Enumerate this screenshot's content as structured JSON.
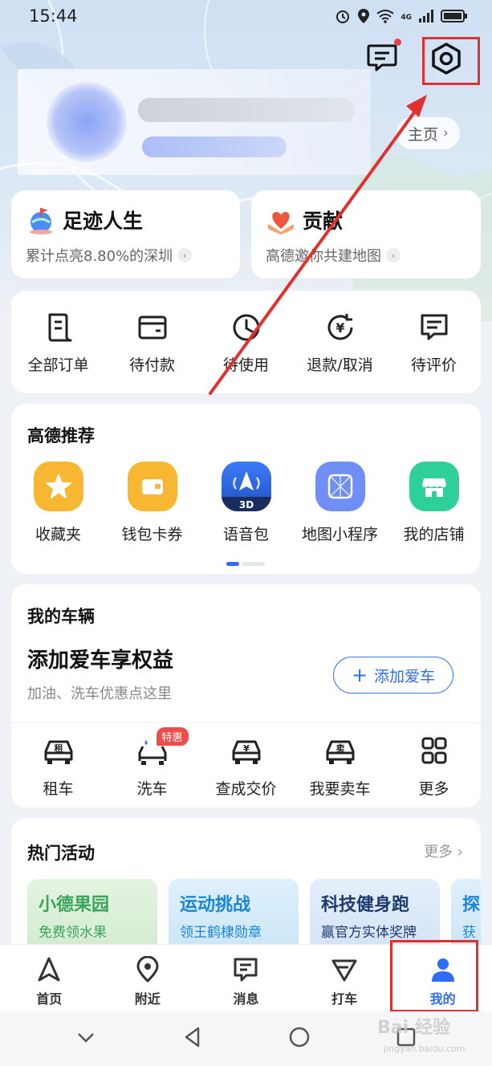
{
  "status_bar": {
    "time": "15:44",
    "network": "4G"
  },
  "header": {
    "home_link": "主页"
  },
  "features": [
    {
      "title": "足迹人生",
      "subtitle": "累计点亮8.80%的深圳"
    },
    {
      "title": "贡献",
      "subtitle": "高德邀你共建地图"
    }
  ],
  "orders": [
    {
      "label": "全部订单",
      "icon": "order-list-icon"
    },
    {
      "label": "待付款",
      "icon": "wallet-icon"
    },
    {
      "label": "待使用",
      "icon": "clock-icon"
    },
    {
      "label": "退款/取消",
      "icon": "refund-icon"
    },
    {
      "label": "待评价",
      "icon": "review-icon"
    }
  ],
  "recommend": {
    "title": "高德推荐",
    "items": [
      {
        "label": "收藏夹",
        "icon": "star-icon",
        "color": "#f7b733"
      },
      {
        "label": "钱包卡券",
        "icon": "wallet-card-icon",
        "color": "#f7b733"
      },
      {
        "label": "语音包",
        "icon": "voice-3d-icon",
        "color": "#2f6cf6",
        "badge": "3D"
      },
      {
        "label": "地图小程序",
        "icon": "map-app-icon",
        "color": "#6f8ff7"
      },
      {
        "label": "我的店铺",
        "icon": "shop-icon",
        "color": "#2fcf9a"
      }
    ],
    "page": 1,
    "pages": 2
  },
  "vehicle": {
    "title": "我的车辆",
    "headline": "添加爱车享权益",
    "description": "加油、洗车优惠点这里",
    "add_button": "添加爱车",
    "items": [
      {
        "label": "租车",
        "icon": "rent-car-icon",
        "glyph": "租"
      },
      {
        "label": "洗车",
        "icon": "car-wash-icon",
        "badge": "特惠"
      },
      {
        "label": "查成交价",
        "icon": "price-check-icon",
        "glyph": "¥"
      },
      {
        "label": "我要卖车",
        "icon": "sell-car-icon",
        "glyph": "卖"
      },
      {
        "label": "更多",
        "icon": "grid-more-icon"
      }
    ]
  },
  "activities": {
    "title": "热门活动",
    "more": "更多",
    "tiles": [
      {
        "title": "小德果园",
        "subtitle": "免费领水果",
        "color": "#3aa55a"
      },
      {
        "title": "运动挑战",
        "subtitle": "领王鹤棣勋章",
        "color": "#1a86d8"
      },
      {
        "title": "科技健身跑",
        "subtitle": "赢官方实体奖牌",
        "color": "#1f3a6e"
      },
      {
        "title": "探",
        "subtitle": "获",
        "color": "#1a86d8"
      }
    ]
  },
  "tabbar": [
    {
      "label": "首页",
      "icon": "navigate-arrow-icon",
      "active": false
    },
    {
      "label": "附近",
      "icon": "location-pin-icon",
      "active": false
    },
    {
      "label": "消息",
      "icon": "message-icon",
      "active": false
    },
    {
      "label": "打车",
      "icon": "taxi-icon",
      "active": false
    },
    {
      "label": "我的",
      "icon": "person-icon",
      "active": true
    }
  ],
  "watermark": {
    "main": "Bai 经验",
    "sub": "jingyan.baidu.com"
  },
  "colors": {
    "accent": "#2f6cf6",
    "annotation": "#e03030",
    "background": "#eef1f5"
  }
}
